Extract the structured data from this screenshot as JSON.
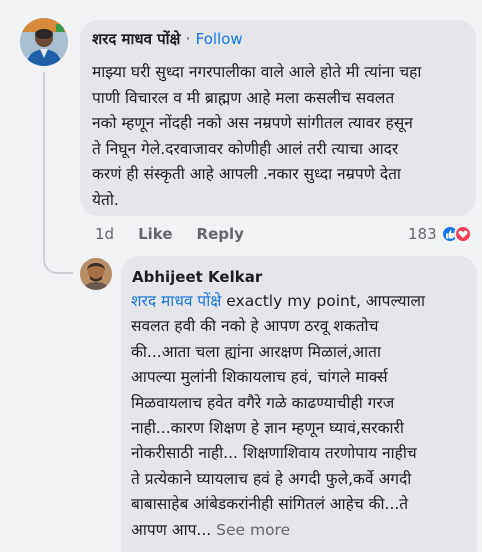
{
  "comments": [
    {
      "author": "शरद माधव पोंक्षे",
      "separator": "·",
      "follow_label": "Follow",
      "text": "माझ्या घरी सुध्दा नगरपालीका वाले आले होते मी त्यांना चहा\nपाणी विचारल व मी ब्राह्मण आहे मला कसलीच सवलत\nनको म्हणून नोंदही नको अस नम्रपणे सांगीतल त्यावर हसून\nते निघून गेले.दरवाजावर कोणीही आलं तरी त्याचा आदर\nकरणं ही संस्कृती आहे आपली .नकार सुध्दा नम्रपणे देता\nयेतो.",
      "time": "1d",
      "like_label": "Like",
      "reply_label": "Reply",
      "reaction_count": "183",
      "reaction_icons": [
        "like-icon",
        "love-icon"
      ]
    },
    {
      "author": "Abhijeet Kelkar",
      "mention": "शरद माधव पोंक्षे",
      "text": " exactly my point, आपल्याला\nसवलत हवी की नको हे आपण ठरवू शकतोच\nकी...आता चला ह्यांना आरक्षण मिळालं,आता\nआपल्या मुलांनी शिकायलाच हवं, चांगले मार्क्स\nमिळवायलाच हवेत वगैरे गळे काढण्याचीही गरज\nनाही...कारण शिक्षण हे ज्ञान म्हणून घ्यावं,सरकारी\nनोकरीसाठी नाही... शिक्षणाशिवाय तरणोपाय नाहीच\nते प्रत्येकाने घ्यायलाच हवं हे अगदी फुले,कर्वे अगदी\nबाबासाहेब आंबेडकरांनीही सांगितलं आहेच की...ते\nआपण आप... ",
      "see_more_label": "See more"
    }
  ],
  "colors": {
    "background": "#f0f2f4",
    "bubble": "#e4e6e9",
    "link": "#1877f2",
    "muted": "#65676b",
    "like": "#1877f2",
    "love": "#f33e58"
  }
}
